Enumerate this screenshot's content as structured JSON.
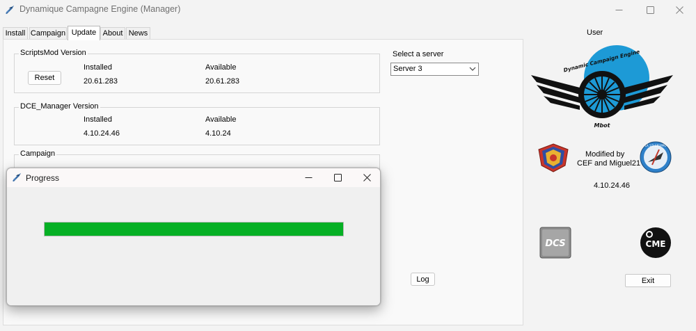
{
  "window": {
    "title": "Dynamique Campagne Engine (Manager)",
    "app_icon": "dce-jet-icon",
    "controls": {
      "minimize": "minimize-icon",
      "maximize": "maximize-icon",
      "close": "close-icon"
    }
  },
  "tabs": [
    {
      "label": "Install",
      "active": false
    },
    {
      "label": "Campaign",
      "active": false
    },
    {
      "label": "Update",
      "active": true
    },
    {
      "label": "About",
      "active": false
    },
    {
      "label": "News",
      "active": false
    }
  ],
  "update": {
    "scriptsmod": {
      "title": "ScriptsMod Version",
      "reset_label": "Reset",
      "installed_label": "Installed",
      "installed_value": "20.61.283",
      "available_label": "Available",
      "available_value": "20.61.283"
    },
    "manager": {
      "title": "DCE_Manager Version",
      "installed_label": "Installed",
      "installed_value": "4.10.24.46",
      "available_label": "Available",
      "available_value": "4.10.24"
    },
    "campaign": {
      "title": "Campaign"
    },
    "server": {
      "label": "Select a server",
      "selected": "Server 3"
    },
    "log_label": "Log"
  },
  "side": {
    "user_label": "User",
    "logo_caption": "Mbot",
    "logo_arc_text": "Dynamic Campaign Engine",
    "modified_by_line1": "Modified by",
    "modified_by_line2": "CEF and Miguel21",
    "version": "4.10.24.46",
    "badge_right_text": "LA 1/2 GRUPPO",
    "dcs_logo_text": "DCS",
    "cme_logo_text": "CME",
    "exit_label": "Exit"
  },
  "progress_dialog": {
    "title": "Progress",
    "progress": 1.0,
    "bar_color": "#06b025"
  }
}
